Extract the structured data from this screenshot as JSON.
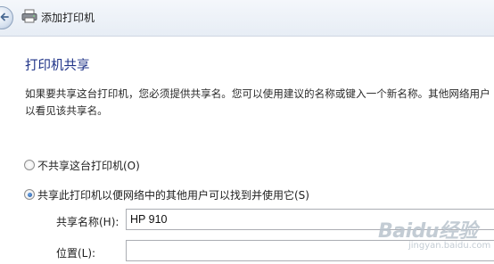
{
  "window": {
    "title": "添加打印机"
  },
  "page": {
    "heading": "打印机共享",
    "description_line1": "如果要共享这台打印机，您必须提供共享名。您可以使用建议的名称或键入一个新名称。其他网络用户",
    "description_line2": "以看见该共享名。"
  },
  "options": {
    "no_share_label": "不共享这台打印机(O)",
    "share_label": "共享此打印机以便网络中的其他用户可以找到并使用它(S)",
    "selected": "share"
  },
  "fields": {
    "share_name_label": "共享名称(H):",
    "share_name_value": "HP 910",
    "location_label": "位置(L):",
    "location_value": ""
  },
  "watermark": {
    "brand": "Baidu经验",
    "url": "jingyan.baidu.com"
  }
}
